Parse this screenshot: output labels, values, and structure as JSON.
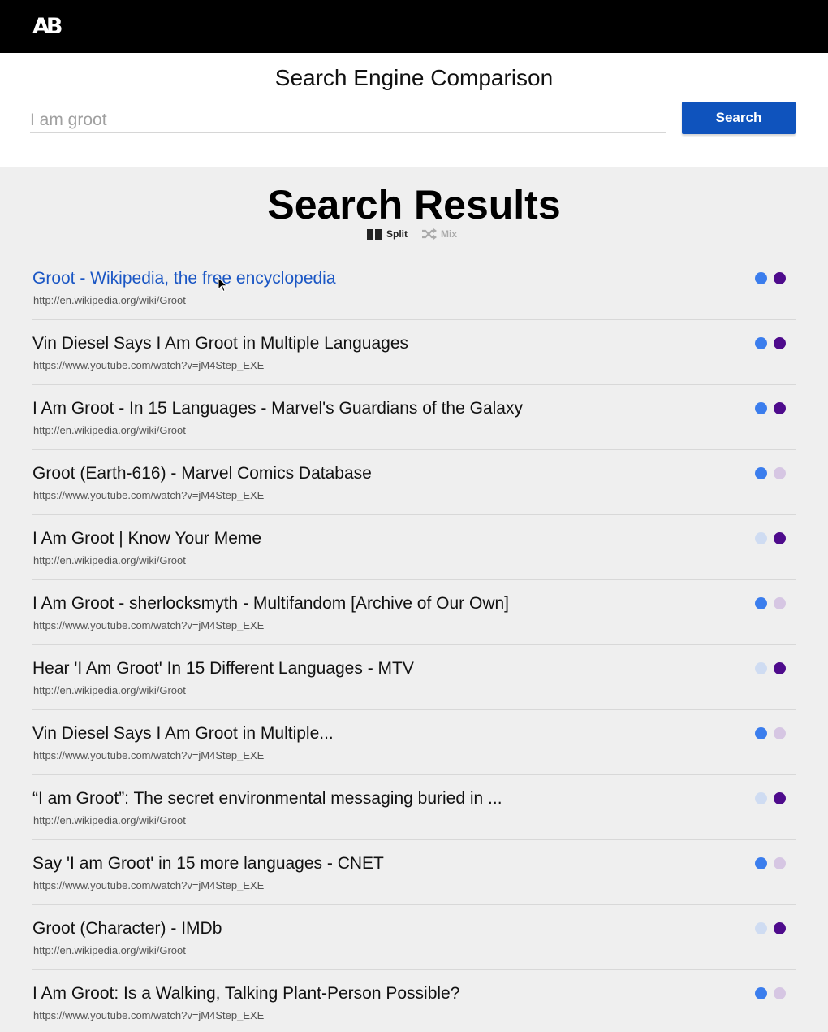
{
  "header": {
    "logo": "AB"
  },
  "search": {
    "title": "Search Engine Comparison",
    "query": "I am groot",
    "button_label": "Search"
  },
  "results_section": {
    "heading": "Search Results",
    "view_modes": {
      "split": "Split",
      "mix": "Mix",
      "selected": "split"
    }
  },
  "colors": {
    "engine_a": "#3b7ded",
    "engine_a_faded": "#cfdcf2",
    "engine_b": "#4e0b8c",
    "engine_b_faded": "#d6c6e3",
    "link_active": "#1a56c4",
    "search_button": "#0f53bd"
  },
  "results": [
    {
      "title": "Groot - Wikipedia, the free encyclopedia",
      "url": "http://en.wikipedia.org/wiki/Groot",
      "engine_a": true,
      "engine_b": true,
      "hovered": true
    },
    {
      "title": "Vin Diesel Says I Am Groot in Multiple Languages",
      "url": "https://www.youtube.com/watch?v=jM4Step_EXE",
      "engine_a": true,
      "engine_b": true
    },
    {
      "title": "I Am Groot - In 15 Languages - Marvel's Guardians of the Galaxy",
      "url": "http://en.wikipedia.org/wiki/Groot",
      "engine_a": true,
      "engine_b": true
    },
    {
      "title": "Groot (Earth-616) - Marvel Comics Database",
      "url": "https://www.youtube.com/watch?v=jM4Step_EXE",
      "engine_a": true,
      "engine_b": false
    },
    {
      "title": "I Am Groot | Know Your Meme",
      "url": "http://en.wikipedia.org/wiki/Groot",
      "engine_a": false,
      "engine_b": true
    },
    {
      "title": "I Am Groot - sherlocksmyth - Multifandom [Archive of Our Own]",
      "url": "https://www.youtube.com/watch?v=jM4Step_EXE",
      "engine_a": true,
      "engine_b": false
    },
    {
      "title": "Hear 'I Am Groot' In 15 Different Languages - MTV",
      "url": "http://en.wikipedia.org/wiki/Groot",
      "engine_a": false,
      "engine_b": true
    },
    {
      "title": "Vin Diesel Says I Am Groot in Multiple...",
      "url": "https://www.youtube.com/watch?v=jM4Step_EXE",
      "engine_a": true,
      "engine_b": false
    },
    {
      "title": "“I am Groot”: The secret environmental messaging buried in ...",
      "url": "http://en.wikipedia.org/wiki/Groot",
      "engine_a": false,
      "engine_b": true
    },
    {
      "title": "Say 'I am Groot' in 15 more languages - CNET",
      "url": "https://www.youtube.com/watch?v=jM4Step_EXE",
      "engine_a": true,
      "engine_b": false
    },
    {
      "title": "Groot (Character) - IMDb",
      "url": "http://en.wikipedia.org/wiki/Groot",
      "engine_a": false,
      "engine_b": true
    },
    {
      "title": "I Am Groot: Is a Walking, Talking Plant-Person Possible?",
      "url": "https://www.youtube.com/watch?v=jM4Step_EXE",
      "engine_a": true,
      "engine_b": false
    }
  ]
}
